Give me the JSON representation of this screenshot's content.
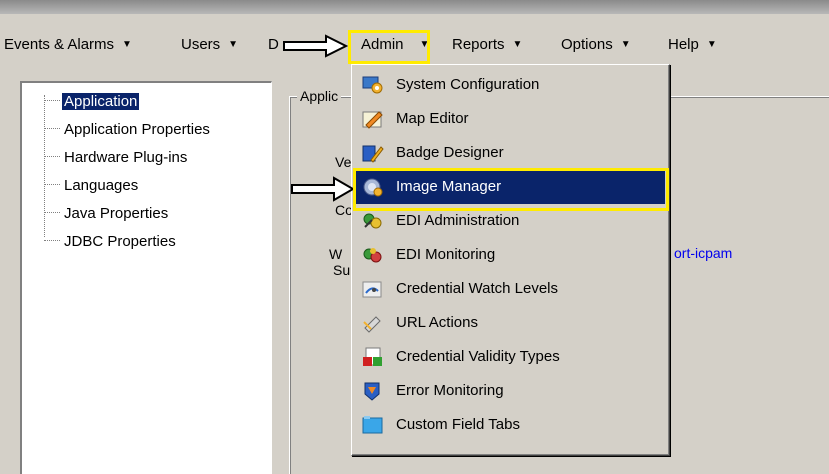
{
  "menubar": {
    "items": [
      {
        "label": "Events & Alarms",
        "caret": "▼"
      },
      {
        "label": "Users",
        "caret": "▼"
      },
      {
        "label": "D",
        "caret": ""
      },
      {
        "label": "Admin",
        "caret": "▼"
      },
      {
        "label": "Reports",
        "caret": "▼"
      },
      {
        "label": "Options",
        "caret": "▼"
      },
      {
        "label": "Help",
        "caret": "▼"
      }
    ]
  },
  "tree": {
    "items": [
      {
        "label": "Application",
        "selected": true
      },
      {
        "label": "Application Properties"
      },
      {
        "label": "Hardware Plug-ins"
      },
      {
        "label": "Languages"
      },
      {
        "label": "Java Properties"
      },
      {
        "label": "JDBC Properties"
      }
    ]
  },
  "content": {
    "group_label": "Applic",
    "frag_ve": "Ve",
    "frag_co": "Co",
    "frag_w": "W",
    "frag_su": "Su",
    "link_text": "ort-icpam"
  },
  "admin_menu": {
    "items": [
      {
        "label": "System Configuration",
        "icon": "system-configuration-icon"
      },
      {
        "label": "Map Editor",
        "icon": "map-editor-icon"
      },
      {
        "label": "Badge Designer",
        "icon": "badge-designer-icon"
      },
      {
        "label": "Image Manager",
        "icon": "image-manager-icon",
        "highlighted": true
      },
      {
        "label": "EDI Administration",
        "icon": "edi-administration-icon"
      },
      {
        "label": "EDI Monitoring",
        "icon": "edi-monitoring-icon"
      },
      {
        "label": "Credential Watch Levels",
        "icon": "credential-watch-levels-icon"
      },
      {
        "label": "URL Actions",
        "icon": "url-actions-icon"
      },
      {
        "label": "Credential Validity Types",
        "icon": "credential-validity-types-icon"
      },
      {
        "label": "Error Monitoring",
        "icon": "error-monitoring-icon"
      },
      {
        "label": "Custom Field Tabs",
        "icon": "custom-field-tabs-icon"
      }
    ]
  },
  "colors": {
    "highlight": "#0a246a",
    "annotation": "#ffeb00",
    "window_bg": "#d4d0c8",
    "link": "#0000ee"
  }
}
